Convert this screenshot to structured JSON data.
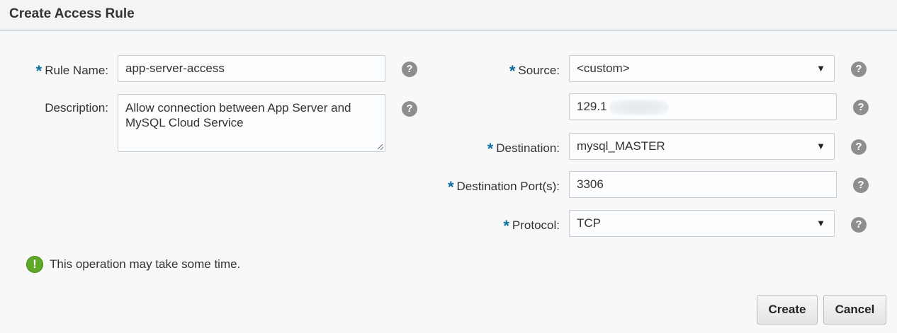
{
  "dialog": {
    "title": "Create Access Rule"
  },
  "form": {
    "required_marker": "*",
    "rule_name": {
      "label": "Rule Name:",
      "value": "app-server-access"
    },
    "description": {
      "label": "Description:",
      "value": "Allow connection between App Server and MySQL Cloud Service"
    },
    "source": {
      "label": "Source:",
      "selected": "<custom>"
    },
    "source_ip": {
      "value": "129.1"
    },
    "destination": {
      "label": "Destination:",
      "selected": "mysql_MASTER"
    },
    "destination_ports": {
      "label": "Destination Port(s):",
      "value": "3306"
    },
    "protocol": {
      "label": "Protocol:",
      "selected": "TCP"
    }
  },
  "icons": {
    "help": "?",
    "info": "!",
    "caret": "▼"
  },
  "notice": {
    "text": "This operation may take some time."
  },
  "buttons": {
    "create_label": "Create",
    "cancel_label": "Cancel"
  },
  "colors": {
    "required_marker": "#0b6fa4",
    "info_icon": "#5fa82a",
    "help_icon": "#8e8e8e"
  }
}
